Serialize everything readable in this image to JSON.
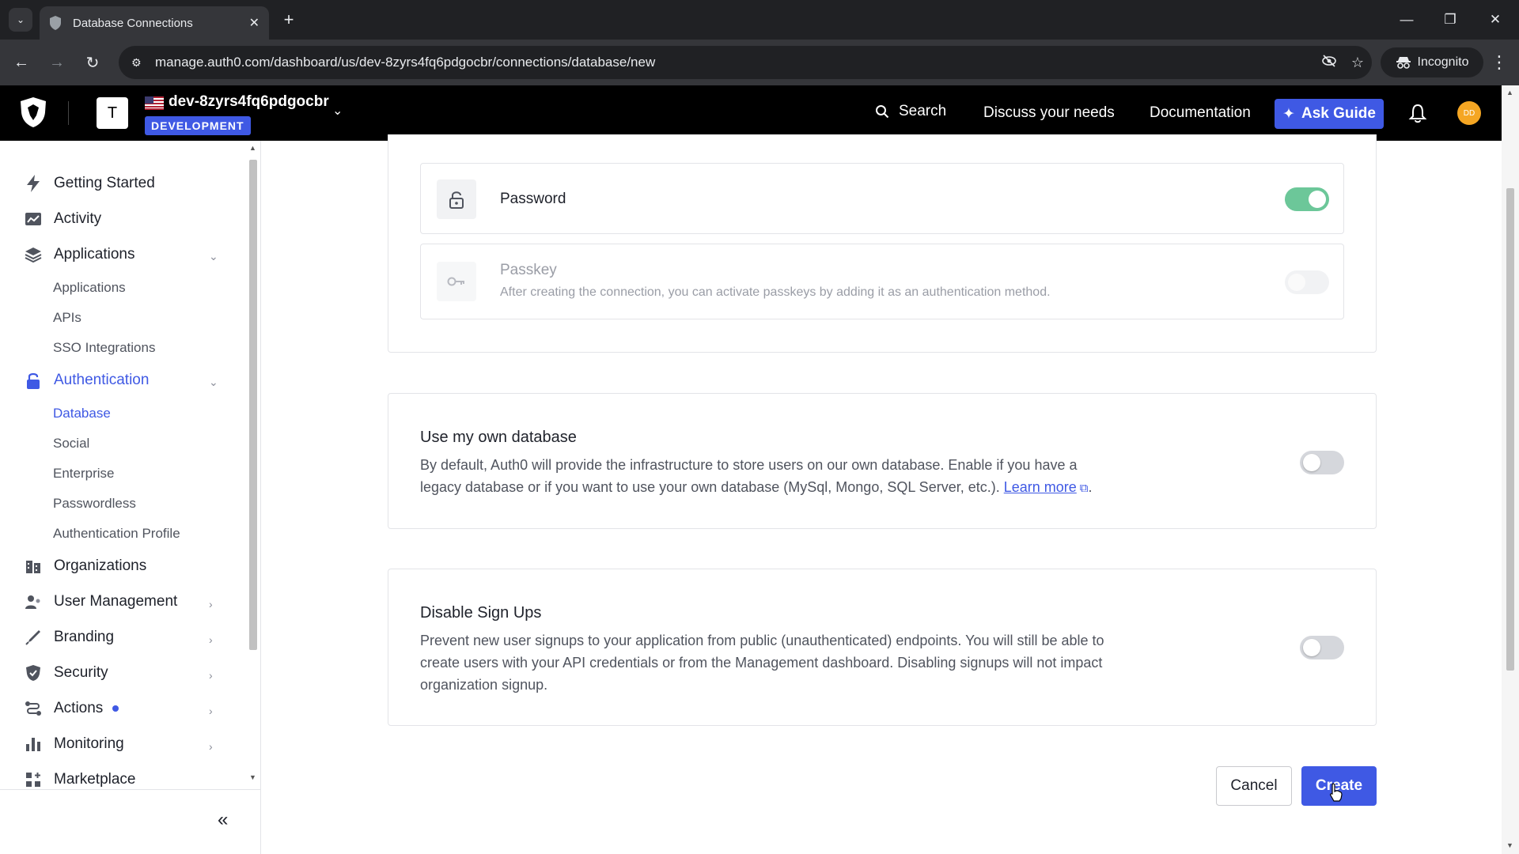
{
  "browser": {
    "tab_title": "Database Connections",
    "url": "manage.auth0.com/dashboard/us/dev-8zyrs4fq6pdgocbr/connections/database/new",
    "incognito_label": "Incognito"
  },
  "header": {
    "tenant_initial": "T",
    "tenant_name": "dev-8zyrs4fq6pdgocbr",
    "environment_badge": "DEVELOPMENT",
    "search_label": "Search",
    "discuss_label": "Discuss your needs",
    "documentation_label": "Documentation",
    "ask_guide_label": "Ask Guide",
    "avatar_initials": "DD"
  },
  "sidebar": {
    "getting_started": "Getting Started",
    "activity": "Activity",
    "applications": "Applications",
    "applications_sub": [
      "Applications",
      "APIs",
      "SSO Integrations"
    ],
    "authentication": "Authentication",
    "authentication_sub": [
      "Database",
      "Social",
      "Enterprise",
      "Passwordless",
      "Authentication Profile"
    ],
    "organizations": "Organizations",
    "user_management": "User Management",
    "branding": "Branding",
    "security": "Security",
    "actions": "Actions",
    "monitoring": "Monitoring",
    "marketplace": "Marketplace",
    "collapse_glyph": "«"
  },
  "auth_methods": {
    "password": {
      "title": "Password",
      "enabled": true
    },
    "passkey": {
      "title": "Passkey",
      "description": "After creating the connection, you can activate passkeys by adding it as an authentication method.",
      "enabled": false
    }
  },
  "own_database": {
    "title": "Use my own database",
    "description": "By default, Auth0 will provide the infrastructure to store users on our own database. Enable if you have a legacy database or if you want to use your own database (MySql, Mongo, SQL Server, etc.).",
    "learn_more": "Learn more",
    "enabled": false
  },
  "disable_signups": {
    "title": "Disable Sign Ups",
    "description": "Prevent new user signups to your application from public (unauthenticated) endpoints. You will still be able to create users with your API credentials or from the Management dashboard. Disabling signups will not impact organization signup.",
    "enabled": false
  },
  "footer": {
    "cancel_label": "Cancel",
    "create_label": "Create"
  },
  "colors": {
    "accent": "#3f59e4",
    "toggle_on": "#6cc799",
    "toggle_off": "#d5d7dc",
    "header_bg": "#000000"
  }
}
